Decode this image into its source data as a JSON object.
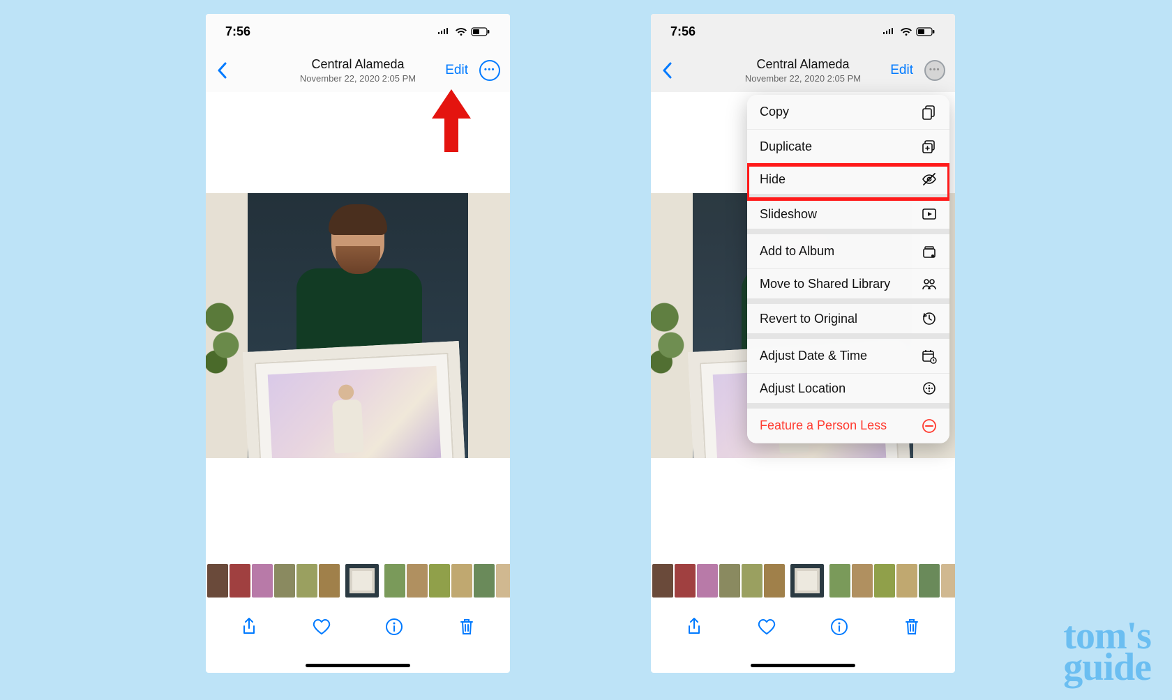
{
  "status": {
    "time": "7:56"
  },
  "nav": {
    "title": "Central Alameda",
    "subtitle": "November 22, 2020  2:05 PM",
    "edit": "Edit"
  },
  "menu": {
    "items": [
      {
        "label": "Copy",
        "icon": "copy"
      },
      {
        "label": "Duplicate",
        "icon": "duplicate"
      },
      {
        "label": "Hide",
        "icon": "hide",
        "highlight": true,
        "sep": true
      },
      {
        "label": "Slideshow",
        "icon": "slideshow",
        "sep": true
      },
      {
        "label": "Add to Album",
        "icon": "album"
      },
      {
        "label": "Move to Shared Library",
        "icon": "shared",
        "sep": true
      },
      {
        "label": "Revert to Original",
        "icon": "revert",
        "sep": true
      },
      {
        "label": "Adjust Date & Time",
        "icon": "datetime"
      },
      {
        "label": "Adjust Location",
        "icon": "location",
        "sep": true
      },
      {
        "label": "Feature a Person Less",
        "icon": "less",
        "red": true
      }
    ]
  },
  "watermark": {
    "line1": "tom's",
    "line2": "guide"
  }
}
